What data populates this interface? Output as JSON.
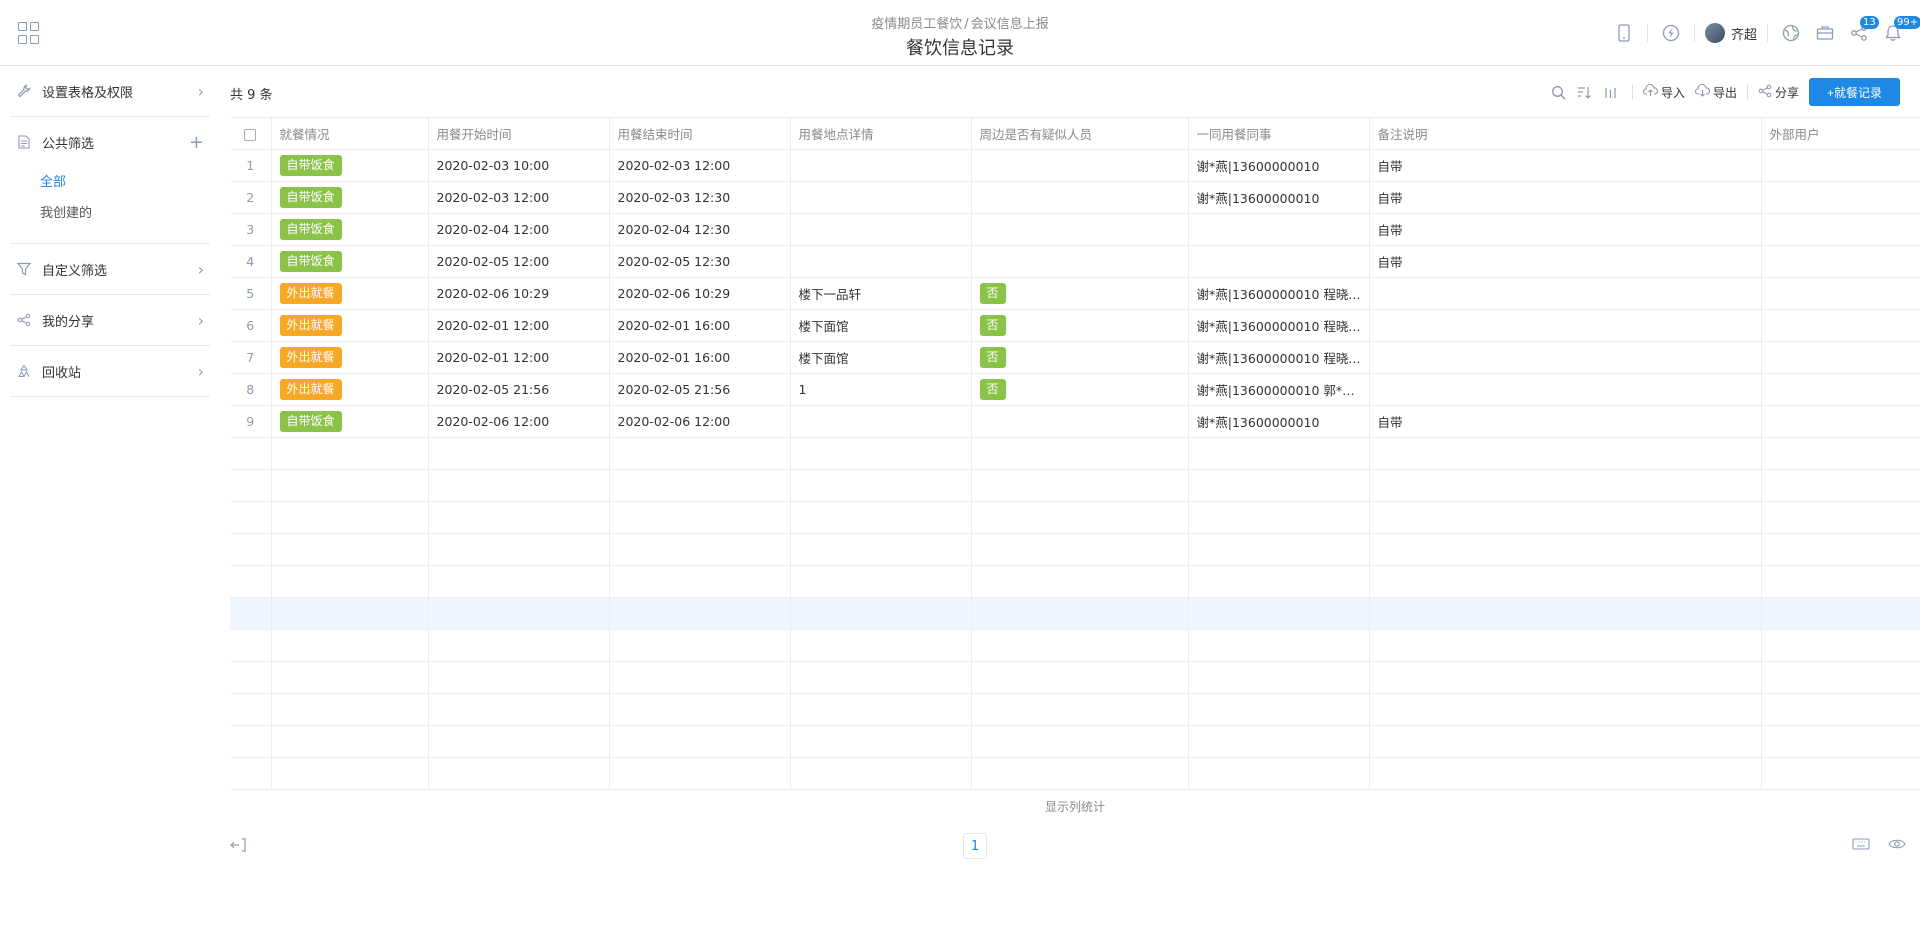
{
  "header": {
    "breadcrumb": [
      "疫情期员工餐饮",
      "会议信息上报"
    ],
    "breadcrumb_sep": "/",
    "title": "餐饮信息记录",
    "user_name": "齐超",
    "notification_badge_1": "13",
    "notification_badge_2": "99+"
  },
  "sidebar": {
    "settings": "设置表格及权限",
    "public_filter": "公共筛选",
    "public_filter_items": [
      "全部",
      "我创建的"
    ],
    "custom_filter": "自定义筛选",
    "my_share": "我的分享",
    "recycle_bin": "回收站"
  },
  "toolbar": {
    "count": "共 9 条",
    "import": "导入",
    "export": "导出",
    "share": "分享",
    "add_button": "+就餐记录"
  },
  "table": {
    "columns": [
      "就餐情况",
      "用餐开始时间",
      "用餐结束时间",
      "用餐地点详情",
      "周边是否有疑似人员",
      "一同用餐同事",
      "备注说明",
      "外部用户"
    ],
    "rows": [
      {
        "idx": "1",
        "status": "自带饭食",
        "status_color": "green",
        "start": "2020-02-03 10:00",
        "end": "2020-02-03 12:00",
        "place": "",
        "suspect": "",
        "colleagues": "谢*燕|13600000010",
        "note": "自带",
        "external": ""
      },
      {
        "idx": "2",
        "status": "自带饭食",
        "status_color": "green",
        "start": "2020-02-03 12:00",
        "end": "2020-02-03 12:30",
        "place": "",
        "suspect": "",
        "colleagues": "谢*燕|13600000010",
        "note": "自带",
        "external": ""
      },
      {
        "idx": "3",
        "status": "自带饭食",
        "status_color": "green",
        "start": "2020-02-04 12:00",
        "end": "2020-02-04 12:30",
        "place": "",
        "suspect": "",
        "colleagues": "",
        "note": "自带",
        "external": ""
      },
      {
        "idx": "4",
        "status": "自带饭食",
        "status_color": "green",
        "start": "2020-02-05 12:00",
        "end": "2020-02-05 12:30",
        "place": "",
        "suspect": "",
        "colleagues": "",
        "note": "自带",
        "external": ""
      },
      {
        "idx": "5",
        "status": "外出就餐",
        "status_color": "orange",
        "start": "2020-02-06 10:29",
        "end": "2020-02-06 10:29",
        "place": "楼下一品轩",
        "suspect": "否",
        "colleagues": "谢*燕|13600000010 程晓...",
        "note": "",
        "external": ""
      },
      {
        "idx": "6",
        "status": "外出就餐",
        "status_color": "orange",
        "start": "2020-02-01 12:00",
        "end": "2020-02-01 16:00",
        "place": "楼下面馆",
        "suspect": "否",
        "colleagues": "谢*燕|13600000010 程晓...",
        "note": "",
        "external": ""
      },
      {
        "idx": "7",
        "status": "外出就餐",
        "status_color": "orange",
        "start": "2020-02-01 12:00",
        "end": "2020-02-01 16:00",
        "place": "楼下面馆",
        "suspect": "否",
        "colleagues": "谢*燕|13600000010 程晓...",
        "note": "",
        "external": ""
      },
      {
        "idx": "8",
        "status": "外出就餐",
        "status_color": "orange",
        "start": "2020-02-05 21:56",
        "end": "2020-02-05 21:56",
        "place": "1",
        "suspect": "否",
        "colleagues": "谢*燕|13600000010 郭*礼...",
        "note": "",
        "external": ""
      },
      {
        "idx": "9",
        "status": "自带饭食",
        "status_color": "green",
        "start": "2020-02-06 12:00",
        "end": "2020-02-06 12:00",
        "place": "",
        "suspect": "",
        "colleagues": "谢*燕|13600000010",
        "note": "自带",
        "external": ""
      }
    ],
    "empty_rows": 11,
    "highlight_empty_row": 5
  },
  "footer": {
    "show_stats": "显示列统计",
    "page": "1"
  },
  "colors": {
    "accent": "#1e88e5",
    "tag_green": "#8bc34a",
    "tag_orange": "#f9a825"
  }
}
